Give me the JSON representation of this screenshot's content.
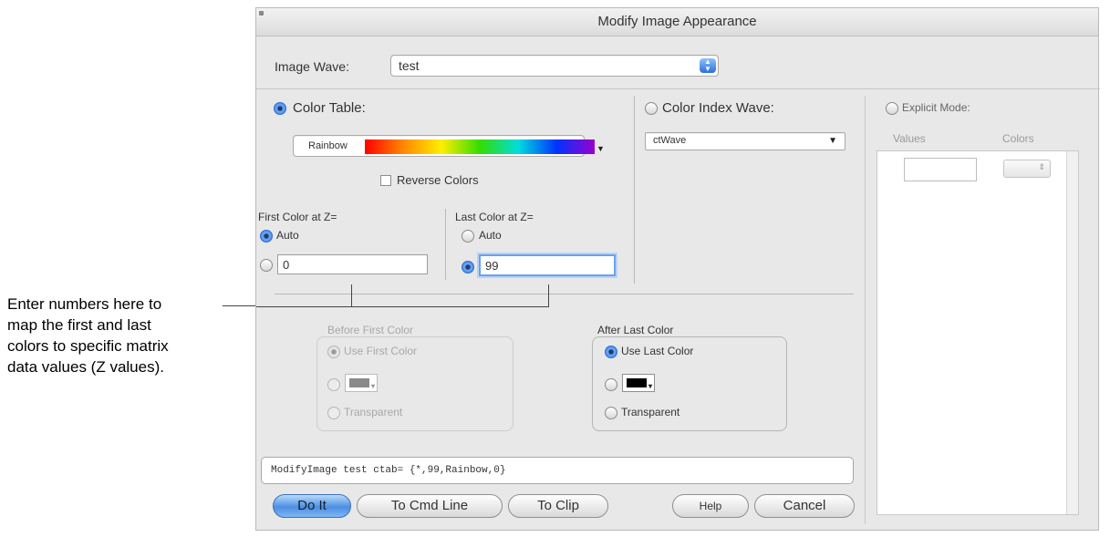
{
  "annotation": {
    "lines": [
      "Enter numbers here to",
      "map the first and last",
      "colors to specific matrix",
      "data values (Z values)."
    ]
  },
  "dialog": {
    "title": "Modify Image Appearance",
    "image_wave": {
      "label": "Image Wave:",
      "value": "test"
    },
    "color_table": {
      "label": "Color Table:",
      "selected": true,
      "table_name": "Rainbow",
      "reverse_colors_label": "Reverse Colors",
      "reverse_colors_checked": false
    },
    "color_index_wave": {
      "label": "Color Index Wave:",
      "selected": false,
      "value": "ctWave"
    },
    "explicit_mode": {
      "label": "Explicit Mode:",
      "selected": false,
      "values_header": "Values",
      "colors_header": "Colors"
    },
    "first_color": {
      "label": "First Color at Z=",
      "auto_label": "Auto",
      "auto_selected": true,
      "value": "0"
    },
    "last_color": {
      "label": "Last Color at Z=",
      "auto_label": "Auto",
      "auto_selected": false,
      "value": "99"
    },
    "before_first_color": {
      "label": "Before First Color",
      "enabled": false,
      "use_first_label": "Use First Color",
      "transparent_label": "Transparent",
      "swatch_color": "#8a8a8a"
    },
    "after_last_color": {
      "label": "After Last Color",
      "enabled": true,
      "use_last_label": "Use Last Color",
      "transparent_label": "Transparent",
      "swatch_color": "#000000"
    },
    "command_text": "ModifyImage test ctab= {*,99,Rainbow,0}",
    "buttons": {
      "do_it": "Do It",
      "to_cmd_line": "To Cmd Line",
      "to_clip": "To Clip",
      "help": "Help",
      "cancel": "Cancel"
    }
  },
  "colors": {
    "accent": "#3b7ee6",
    "default_button": "#4c8fe2",
    "window_bg": "#e8e8e8"
  }
}
